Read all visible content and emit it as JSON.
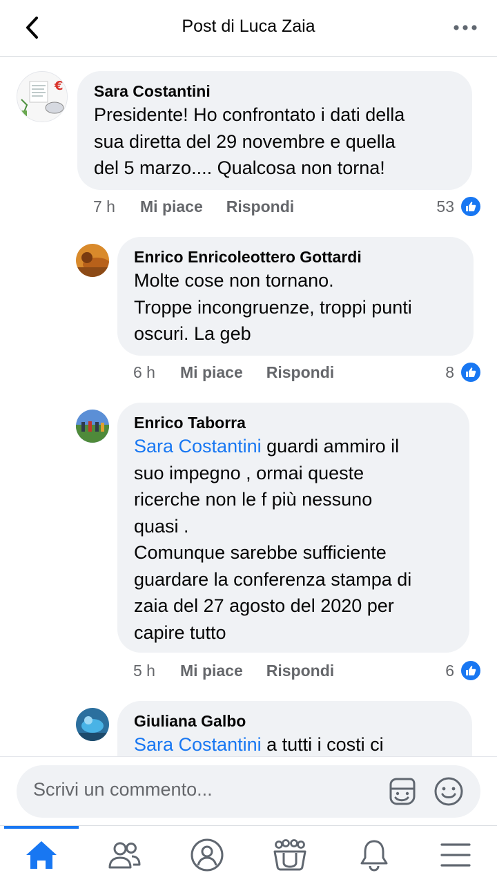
{
  "header": {
    "title": "Post di Luca Zaia",
    "back_icon": "chevron-left-icon",
    "more_icon": "more-horizontal-icon"
  },
  "comments": [
    {
      "author": "Sara Costantini",
      "text": "Presidente! Ho confrontato i dati della\nsua diretta del 29 novembre e quella\ndel 5 marzo.... Qualcosa non torna!",
      "time": "7 h",
      "like_label": "Mi piace",
      "reply_label": "Rispondi",
      "reactions": "53"
    },
    {
      "author": "Enrico Enricoleottero Gottardi",
      "text": "Molte cose non tornano.\nTroppe incongruenze, troppi punti\noscuri. La geb",
      "time": "6 h",
      "like_label": "Mi piace",
      "reply_label": "Rispondi",
      "reactions": "8"
    },
    {
      "author": "Enrico Taborra",
      "mention": "Sara Costantini",
      "text": " guardi ammiro il\nsuo impegno , ormai queste\nricerche non le f più nessuno\nquasi .\nComunque sarebbe sufficiente\nguardare la conferenza stampa di\nzaia del 27 agosto del 2020 per\ncapire tutto",
      "time": "5 h",
      "like_label": "Mi piace",
      "reply_label": "Rispondi",
      "reactions": "6"
    },
    {
      "author": "Giuliana Galbo",
      "mention": "Sara Costantini",
      "text": " a tutti i costi ci"
    }
  ],
  "composer": {
    "placeholder": "Scrivi un commento...",
    "sticker_icon": "sticker-icon",
    "emoji_icon": "emoji-icon"
  },
  "nav": {
    "items": [
      "home-icon",
      "friends-icon",
      "profile-icon",
      "groups-icon",
      "notifications-icon",
      "menu-icon"
    ],
    "active": "home-icon"
  },
  "colors": {
    "accent": "#1877f2",
    "bubble": "#f0f2f5",
    "secondary_text": "#65676b"
  }
}
